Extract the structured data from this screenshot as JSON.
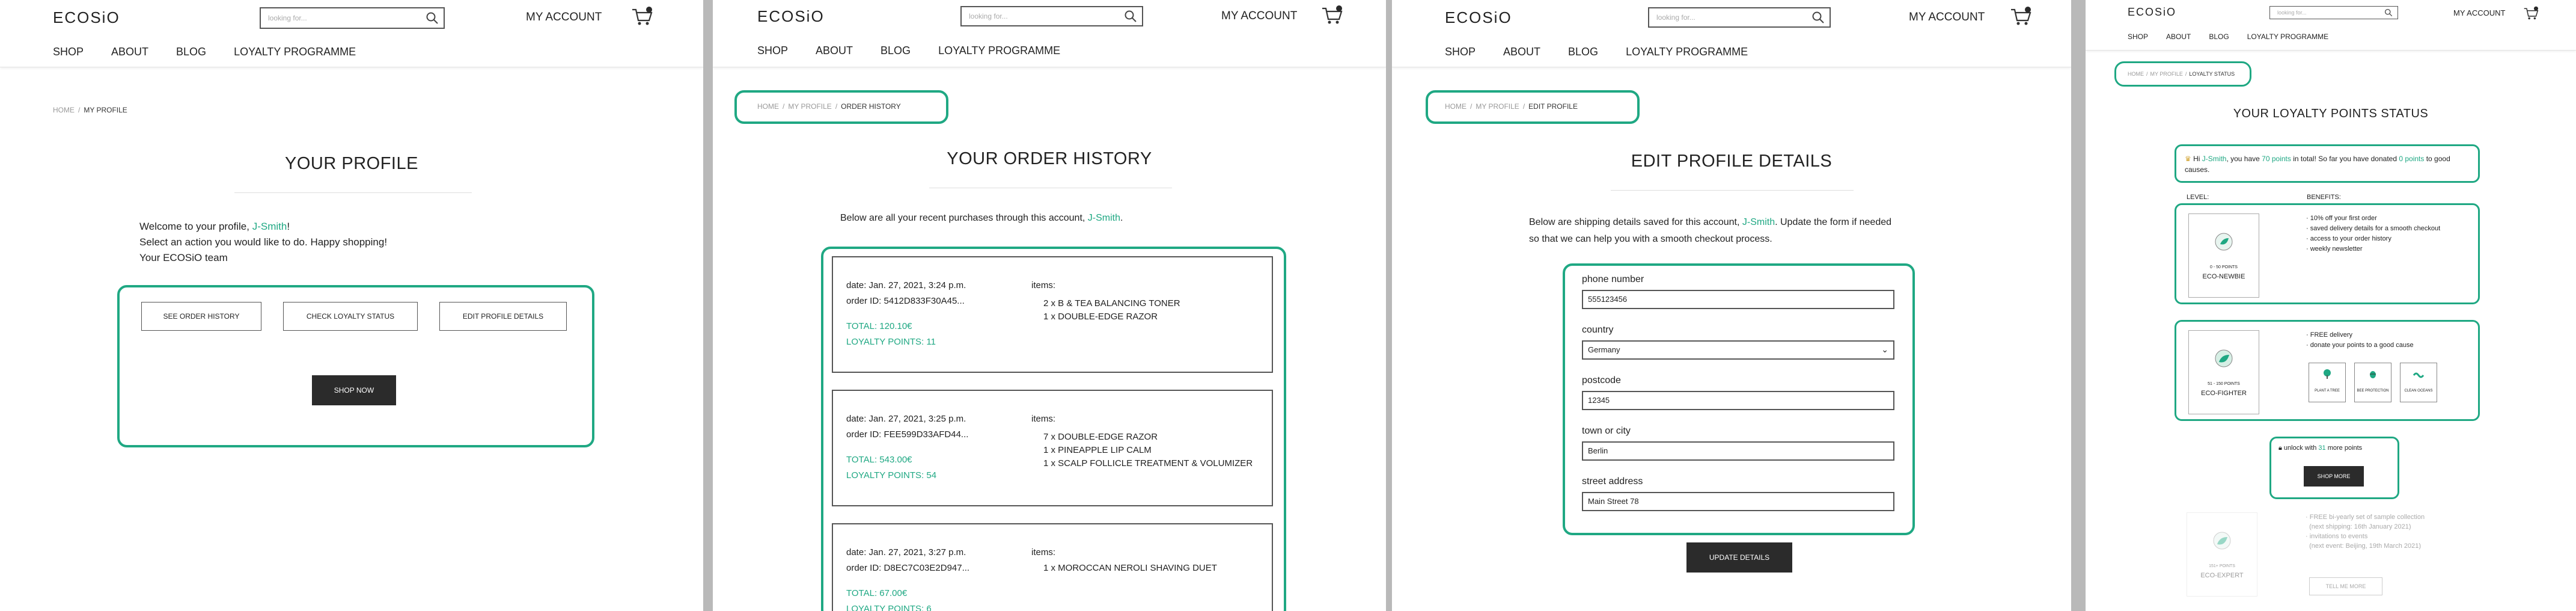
{
  "header": {
    "logo": "ECOSiO",
    "search_placeholder": "looking for...",
    "account_label": "MY ACCOUNT",
    "nav": [
      "SHOP",
      "ABOUT",
      "BLOG",
      "LOYALTY PROGRAMME"
    ],
    "cart_count": "0"
  },
  "profile": {
    "breadcrumb": [
      "HOME",
      "MY PROFILE"
    ],
    "title": "YOUR PROFILE",
    "welcome_pre": "Welcome to your profile, ",
    "username": "J-Smith",
    "welcome_post": "!",
    "line2": "Select an action you would like to do. Happy shopping!",
    "line3": "Your ECOSiO team",
    "btn_orders": "SEE ORDER HISTORY",
    "btn_loyalty": "CHECK LOYALTY STATUS",
    "btn_edit": "EDIT PROFILE DETAILS",
    "btn_shop": "SHOP NOW"
  },
  "orders": {
    "breadcrumb": [
      "HOME",
      "MY PROFILE",
      "ORDER HISTORY"
    ],
    "title": "YOUR ORDER HISTORY",
    "intro_pre": "Below are all your recent purchases through this account, ",
    "username": "J-Smith",
    "intro_post": ".",
    "items_label": "items:",
    "list": [
      {
        "date": "date: Jan. 27, 2021, 3:24 p.m.",
        "id": "order ID: 5412D833F30A45...",
        "total": "TOTAL: 120.10€",
        "points": "LOYALTY POINTS: 11",
        "items": [
          "2 x B & TEA BALANCING TONER",
          "1 x DOUBLE-EDGE RAZOR"
        ]
      },
      {
        "date": "date: Jan. 27, 2021, 3:25 p.m.",
        "id": "order ID: FEE599D33AFD44...",
        "total": "TOTAL: 543.00€",
        "points": "LOYALTY POINTS: 54",
        "items": [
          "7 x DOUBLE-EDGE RAZOR",
          "1 x PINEAPPLE LIP CALM",
          "1 x SCALP FOLLICLE TREATMENT & VOLUMIZER"
        ]
      },
      {
        "date": "date: Jan. 27, 2021, 3:27 p.m.",
        "id": "order ID: D8EC7C03E2D947...",
        "total": "TOTAL: 67.00€",
        "points": "LOYALTY POINTS: 6",
        "items": [
          "1 x MOROCCAN NEROLI SHAVING DUET"
        ]
      }
    ]
  },
  "edit": {
    "breadcrumb": [
      "HOME",
      "MY PROFILE",
      "EDIT PROFILE"
    ],
    "title": "EDIT PROFILE DETAILS",
    "intro_pre": "Below are shipping details saved for this account, ",
    "username": "J-Smith",
    "intro_post": ". Update the form if needed",
    "intro_line2": "so that we can help you with a smooth checkout process.",
    "fields": [
      {
        "label": "phone number",
        "value": "555123456"
      },
      {
        "label": "country",
        "value": "Germany"
      },
      {
        "label": "postcode",
        "value": "12345"
      },
      {
        "label": "town or city",
        "value": "Berlin"
      },
      {
        "label": "street address",
        "value": "Main Street 78"
      }
    ],
    "btn_update": "UPDATE DETAILS"
  },
  "loyalty": {
    "breadcrumb": [
      "HOME",
      "MY PROFILE",
      "LOYALTY STATUS"
    ],
    "title": "YOUR LOYALTY POINTS STATUS",
    "hi_pre": "Hi ",
    "username": "J-Smith",
    "hi_mid": ", you have ",
    "points": "70 points",
    "hi_mid2": " in total! So far you have donated ",
    "donated": "0 points",
    "hi_post": " to good",
    "hi_line2": "causes.",
    "level_label": "LEVEL:",
    "benefits_label": "BENEFITS:",
    "levels": [
      {
        "range": "0 - 50 POINTS",
        "name": "ECO-NEWBIE",
        "benefits": [
          "10% off your first order",
          "saved delivery details for a smooth checkout",
          "access to your order history",
          "weekly newsletter"
        ]
      },
      {
        "range": "51 - 150 POINTS",
        "name": "ECO-FIGHTER",
        "benefits": [
          "FREE delivery",
          "donate your points to a good cause"
        ],
        "causes": [
          "PLANT A TREE",
          "BEE PROTECTION",
          "CLEAN OCEANS"
        ]
      },
      {
        "range": "151+ POINTS",
        "name": "ECO-EXPERT",
        "benefits": [
          "FREE bi-yearly set of sample collection",
          "(next shipping: 16th January 2021)",
          "invitations to events",
          "(next event: Beijing, 19th March 2021)"
        ],
        "btn": "TELL ME MORE"
      }
    ],
    "unlock_pre": "unlock with ",
    "unlock_num": "31",
    "unlock_post": " more points",
    "btn_shop_more": "SHOP MORE"
  }
}
